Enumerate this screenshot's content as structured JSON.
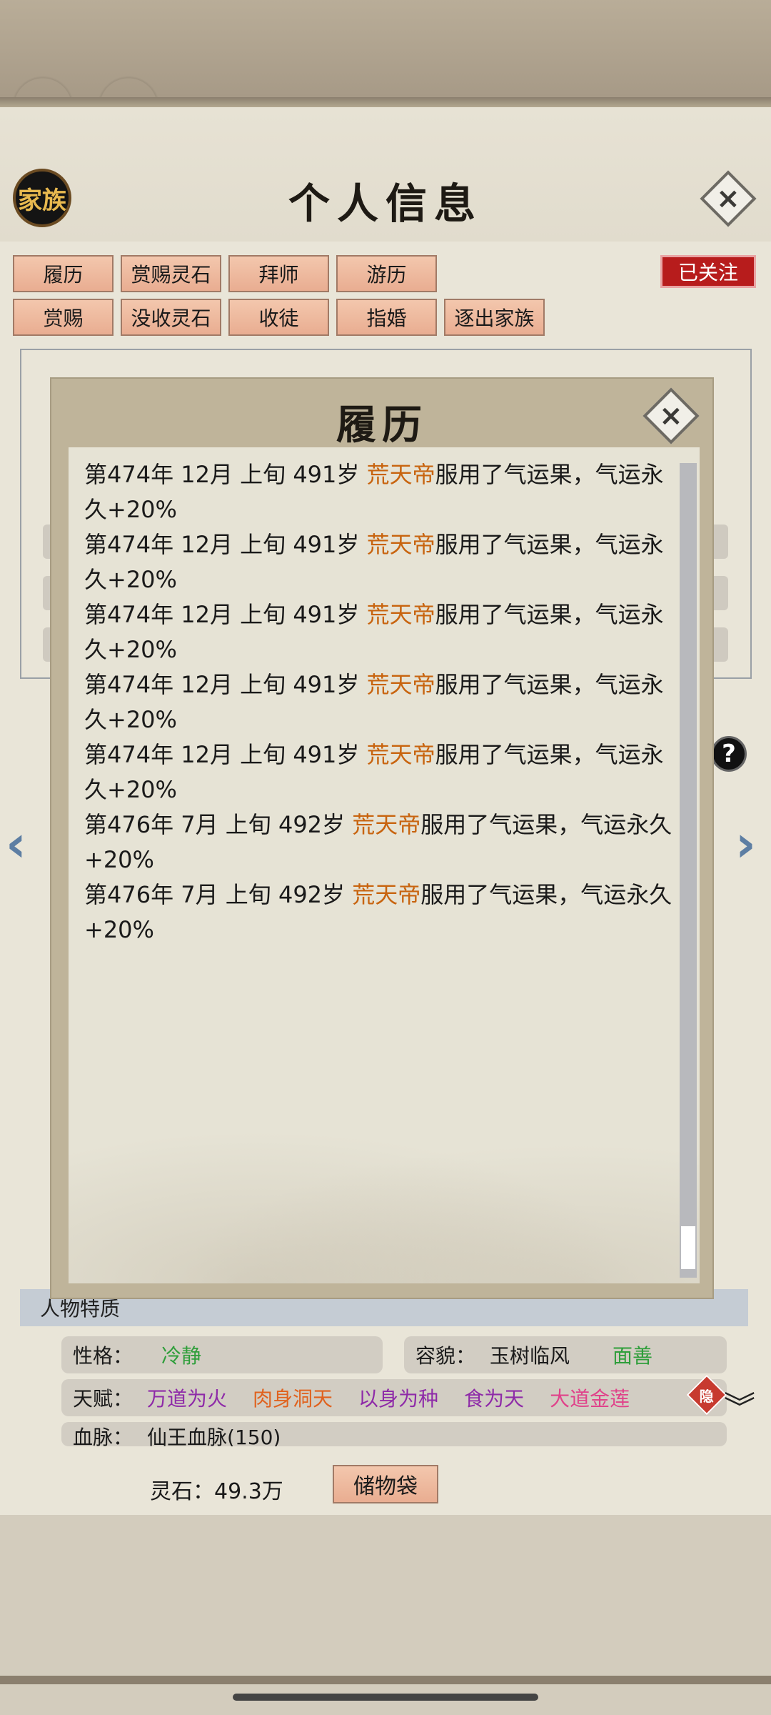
{
  "header": {
    "family_badge": "家族",
    "title": "个人信息",
    "close_symbol": "×"
  },
  "actions": {
    "row1": [
      "履历",
      "赏赐灵石",
      "拜师",
      "游历"
    ],
    "row2": [
      "赏赐",
      "没收灵石",
      "收徒",
      "指婚",
      "逐出家族"
    ],
    "follow": "已关注"
  },
  "modal": {
    "title": "履历",
    "close_symbol": "×",
    "entries": [
      {
        "prefix": "第474年 12月 上旬 491岁 ",
        "name": "荒天帝",
        "text": "服用了气运果，气运永久+20%"
      },
      {
        "prefix": "第474年 12月 上旬 491岁 ",
        "name": "荒天帝",
        "text": "服用了气运果，气运永久+20%"
      },
      {
        "prefix": "第474年 12月 上旬 491岁 ",
        "name": "荒天帝",
        "text": "服用了气运果，气运永久+20%"
      },
      {
        "prefix": "第474年 12月 上旬 491岁 ",
        "name": "荒天帝",
        "text": "服用了气运果，气运永久+20%"
      },
      {
        "prefix": "第474年 12月 上旬 491岁 ",
        "name": "荒天帝",
        "text": "服用了气运果，气运永久+20%"
      },
      {
        "prefix": "第476年 7月 上旬  492岁 ",
        "name": "荒天帝",
        "text": "服用了气运果，气运永久+20%"
      },
      {
        "prefix": "第476年 7月 上旬  492岁 ",
        "name": "荒天帝",
        "text": "服用了气运果，气运永久+20%"
      }
    ]
  },
  "traits": {
    "section_title": "人物特质",
    "personality_label": "性格：",
    "personality_value": "冷静",
    "appearance_label": "容貌：",
    "appearance_value": "玉树临风",
    "appearance_tag": "面善",
    "talent_label": "天赋：",
    "talents": [
      {
        "text": "万道为火",
        "color": "#8e2aa8"
      },
      {
        "text": "肉身洞天",
        "color": "#e0621e"
      },
      {
        "text": "以身为种",
        "color": "#8e2aa8"
      },
      {
        "text": "食为天",
        "color": "#8e2aa8"
      },
      {
        "text": "大道金莲",
        "color": "#e0428a"
      }
    ],
    "hidden_badge": "隐",
    "bloodline_label": "血脉：",
    "bloodline_value": "仙王血脉(150)"
  },
  "footer": {
    "spirit_stone": "灵石：49.3万",
    "bag_button": "储物袋"
  },
  "colors": {
    "highlight_name": "#c8640f",
    "personality_value": "#2e9e3a",
    "appearance_tag": "#2e9e3a"
  },
  "icons": {
    "prev": "‹",
    "next": "›",
    "help": "?",
    "expand": "︾"
  }
}
